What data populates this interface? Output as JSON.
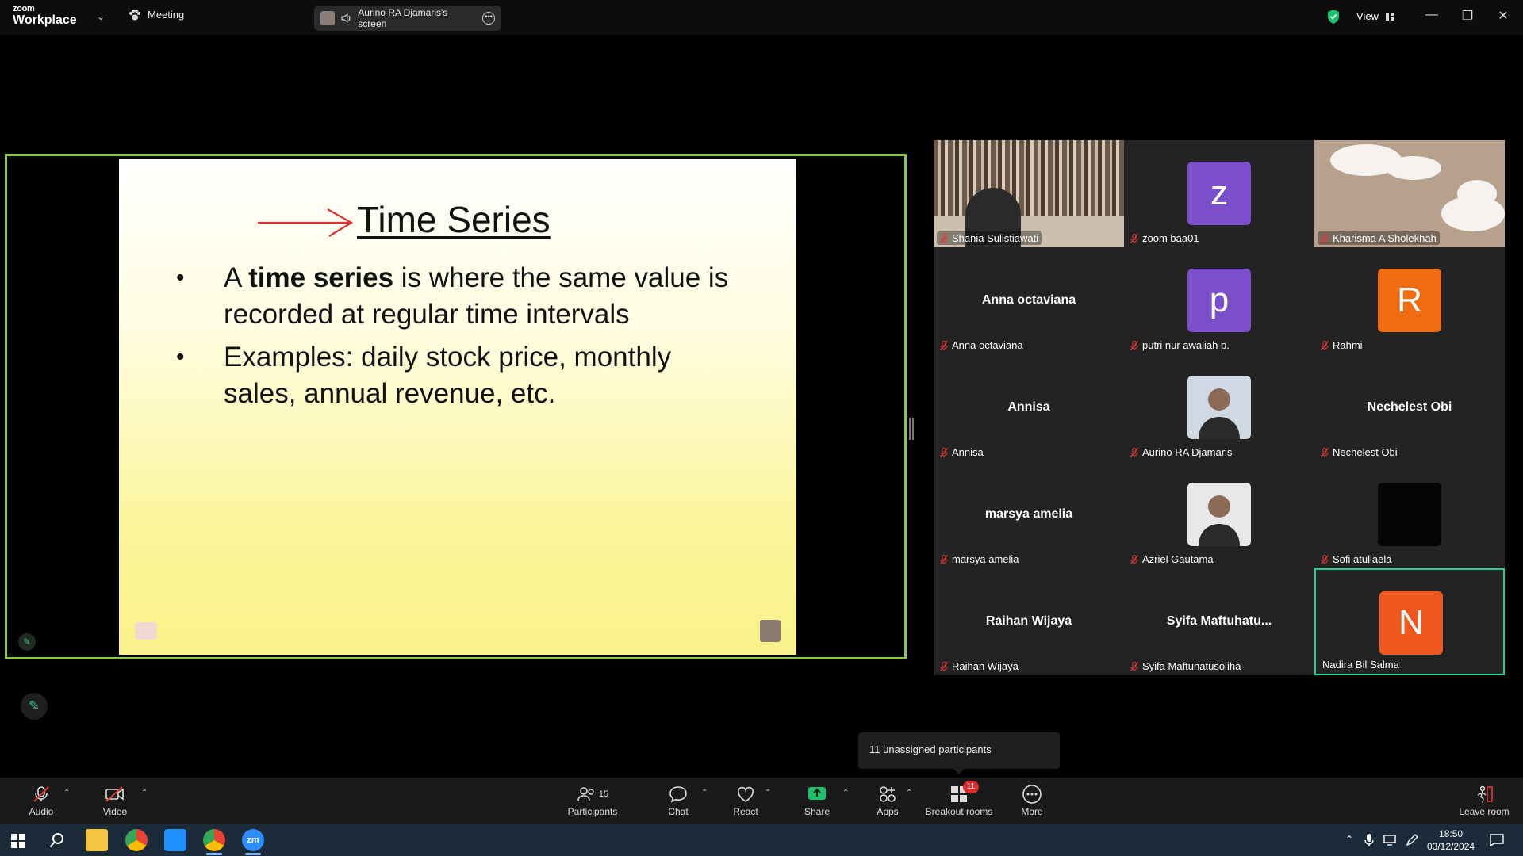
{
  "titlebar": {
    "brand_small": "zoom",
    "brand_large": "Workplace",
    "meeting_label": "Meeting",
    "share_label": "Aurino RA Djamaris's screen",
    "view_label": "View"
  },
  "slide": {
    "title": "Time Series",
    "bullet1_pre": "A ",
    "bullet1_bold": "time series",
    "bullet1_post": " is where the same value is recorded at regular time intervals",
    "bullet2": "Examples: daily stock price, monthly sales, annual revenue, etc."
  },
  "participants_grid": [
    {
      "name": "Shania Sulistiawati",
      "type": "video-books"
    },
    {
      "name": "zoom baa01",
      "type": "letter",
      "letter": "z",
      "color": "#7b4fc9"
    },
    {
      "name": "Kharisma A Sholekhah",
      "type": "video-sky"
    },
    {
      "name": "Anna octaviana",
      "type": "name",
      "display": "Anna octaviana"
    },
    {
      "name": "putri nur awaliah p.",
      "type": "letter",
      "letter": "p",
      "color": "#7b4fc9"
    },
    {
      "name": "Rahmi",
      "type": "letter",
      "letter": "R",
      "color": "#ef6c12"
    },
    {
      "name": "Annisa",
      "type": "name",
      "display": "Annisa"
    },
    {
      "name": "Aurino RA Djamaris",
      "type": "photo",
      "color": "#cfd8e3"
    },
    {
      "name": "Nechelest Obi",
      "type": "name",
      "display": "Nechelest Obi"
    },
    {
      "name": "marsya amelia",
      "type": "name",
      "display": "marsya amelia"
    },
    {
      "name": "Azriel Gautama",
      "type": "photo",
      "color": "#e8e8e8"
    },
    {
      "name": "Sofi atullaela",
      "type": "letter",
      "letter": "",
      "color": "#050505"
    },
    {
      "name": "Raihan Wijaya",
      "type": "name",
      "display": "Raihan Wijaya"
    },
    {
      "name": "Syifa Maftuhatusoliha",
      "type": "name",
      "display": "Syifa  Maftuhatu..."
    },
    {
      "name": "Nadira Bil Salma",
      "type": "letter",
      "letter": "N",
      "color": "#f0571f",
      "active": true
    }
  ],
  "tooltip": "11 unassigned participants",
  "toolbar": {
    "audio": "Audio",
    "video": "Video",
    "participants": "Participants",
    "participants_count": "15",
    "chat": "Chat",
    "react": "React",
    "share": "Share",
    "apps": "Apps",
    "breakout": "Breakout rooms",
    "breakout_badge": "11",
    "more": "More",
    "leave": "Leave room"
  },
  "taskbar": {
    "time": "18:50",
    "date": "03/12/2024"
  },
  "colors": {
    "share_border": "#8dc63f",
    "active_speaker": "#1fd28c",
    "accent_green": "#16c26a"
  }
}
